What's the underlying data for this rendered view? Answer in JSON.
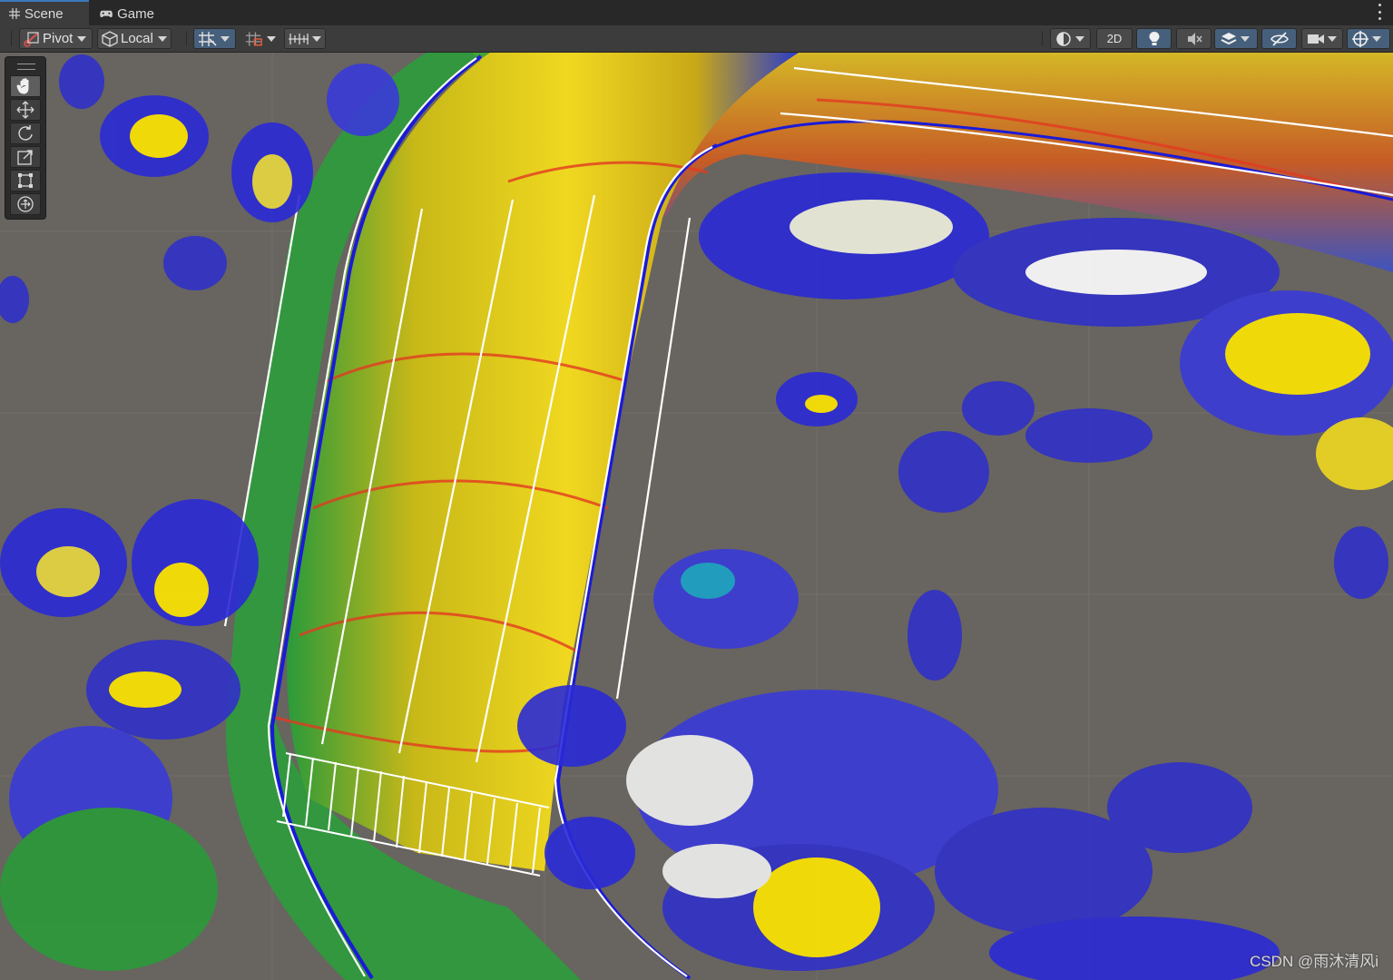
{
  "tabs": [
    {
      "label": "Scene",
      "icon": "grid-icon",
      "active": true
    },
    {
      "label": "Game",
      "icon": "gamepad-icon",
      "active": false
    }
  ],
  "toolbar": {
    "pivot_label": "Pivot",
    "local_label": "Local",
    "mode_2d_label": "2D"
  },
  "tools": [
    "hand-tool",
    "move-tool",
    "rotate-tool",
    "scale-tool",
    "rect-tool",
    "transform-tool"
  ],
  "watermark": "CSDN @雨沐清风i",
  "colors": {
    "background": "#686460",
    "toolbar": "#3c3c3c",
    "tabbar": "#282828",
    "active_toggle": "#46607c",
    "pointcloud_palette": [
      "#ffe600",
      "#ff3b1f",
      "#1fbf3a",
      "#2a2ad6",
      "#ffffff",
      "#1aa3c8"
    ]
  }
}
